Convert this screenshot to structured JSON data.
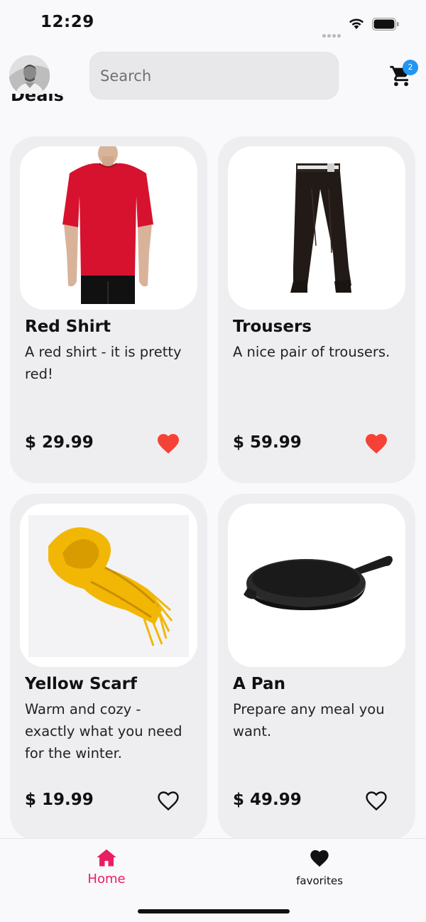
{
  "status_bar": {
    "time": "12:29"
  },
  "header": {
    "search_placeholder": "Search",
    "cart_count": "2",
    "icons": {
      "avatar": "profile-photo",
      "cart": "shopping-cart-icon"
    }
  },
  "section": {
    "title": "Deals"
  },
  "products": [
    {
      "title": "Red Shirt",
      "description": "A red shirt - it is pretty red!",
      "price": "$ 29.99",
      "favorite": true,
      "image": "red-shirt-image"
    },
    {
      "title": "Trousers",
      "description": "A nice pair of trousers.",
      "price": "$ 59.99",
      "favorite": true,
      "image": "trousers-image"
    },
    {
      "title": "Yellow Scarf",
      "description": "Warm and cozy - exactly what you need for the winter.",
      "price": "$ 19.99",
      "favorite": false,
      "image": "yellow-scarf-image"
    },
    {
      "title": "A Pan",
      "description": "Prepare any meal you want.",
      "price": "$ 49.99",
      "favorite": false,
      "image": "pan-image"
    }
  ],
  "bottom_nav": {
    "items": [
      {
        "label": "Home",
        "icon": "home-icon",
        "active": true
      },
      {
        "label": "favorites",
        "icon": "heart-icon",
        "active": false
      }
    ]
  },
  "colors": {
    "accent": "#e91e63",
    "favorite_red": "#f44336",
    "badge_blue": "#2196f3",
    "card_bg": "#eeedf0"
  }
}
